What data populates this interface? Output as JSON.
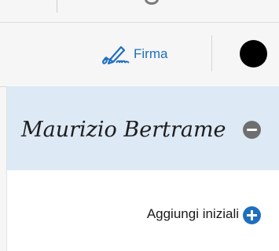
{
  "toolbar": {
    "sign_label": "Firma",
    "sign_icon": "pen-signature-icon",
    "color_swatch": "#000000",
    "accent": "#1f6fbf"
  },
  "panel": {
    "signature": {
      "text": "Maurizio Bertrame",
      "remove_icon": "minus-circle-icon"
    },
    "initials": {
      "label": "Aggiungi iniziali",
      "add_icon": "plus-circle-icon"
    }
  }
}
